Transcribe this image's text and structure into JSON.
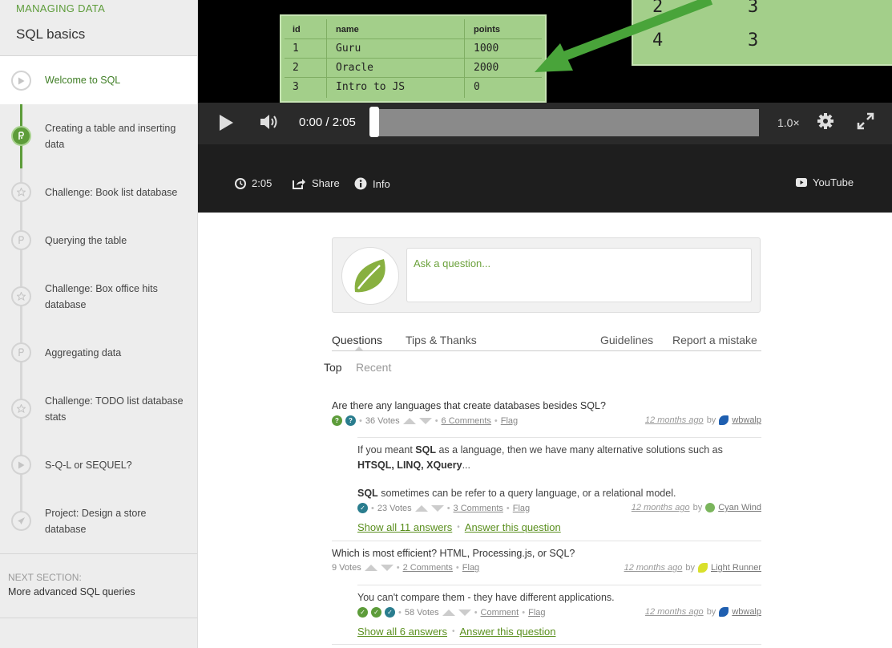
{
  "sidebar": {
    "eyebrow": "MANAGING DATA",
    "title": "SQL basics",
    "items": [
      {
        "label": "Welcome to SQL",
        "icon": "play-icon"
      },
      {
        "label": "Creating a table and inserting data",
        "icon": "talkthrough-icon"
      },
      {
        "label": "Challenge: Book list database",
        "icon": "star-icon"
      },
      {
        "label": "Querying the table",
        "icon": "talkthrough-icon"
      },
      {
        "label": "Challenge: Box office hits database",
        "icon": "star-icon"
      },
      {
        "label": "Aggregating data",
        "icon": "talkthrough-icon"
      },
      {
        "label": "Challenge: TODO list database stats",
        "icon": "star-icon"
      },
      {
        "label": "S-Q-L or SEQUEL?",
        "icon": "play-icon"
      },
      {
        "label": "Project: Design a store database",
        "icon": "rocket-icon"
      }
    ],
    "next_label": "NEXT SECTION:",
    "next_title": "More advanced SQL queries"
  },
  "video": {
    "table1": {
      "headers": [
        "id",
        "name",
        "points"
      ],
      "rows": [
        [
          "1",
          "Guru",
          "1000"
        ],
        [
          "2",
          "Oracle",
          "2000"
        ],
        [
          "3",
          "Intro to JS",
          "0"
        ]
      ]
    },
    "table2": {
      "rows": [
        [
          "2",
          "3"
        ],
        [
          "4",
          "3"
        ]
      ]
    },
    "time": "0:00 / 2:05",
    "progress": 0,
    "speed": "1.0×",
    "duration": "2:05",
    "share": "Share",
    "info": "Info",
    "youtube": "YouTube"
  },
  "ask": {
    "placeholder": "Ask a question..."
  },
  "tabs": {
    "questions": "Questions",
    "tips": "Tips & Thanks",
    "guidelines": "Guidelines",
    "report": "Report a mistake",
    "top": "Top",
    "recent": "Recent"
  },
  "questions": [
    {
      "title": "Are there any languages that create databases besides SQL?",
      "votes": "36 Votes",
      "comments": "6 Comments",
      "flag": "Flag",
      "time": "12 months ago",
      "by": "by",
      "user": "wbwalp",
      "answer_text_1": "If you meant",
      "answer_bold_1": "SQL",
      "answer_text_2": "as a language, then we have many alternative solutions such as",
      "answer_bold_2": "HTSQL, LINQ, XQuery",
      "answer_text_3": "...",
      "answer_bold_3": "SQL",
      "answer_text_4": "sometimes can be refer to a query language, or a relational model.",
      "answer_votes": "23 Votes",
      "answer_comments": "3 Comments",
      "answer_flag": "Flag",
      "answer_time": "12 months ago",
      "answer_by": "by",
      "answer_user": "Cyan Wind",
      "show_all": "Show all 11 answers",
      "answer_this": "Answer this question"
    },
    {
      "title": "Which is most efficient? HTML, Processing.js, or SQL?",
      "votes": "9 Votes",
      "comments": "2 Comments",
      "flag": "Flag",
      "time": "12 months ago",
      "by": "by",
      "user": "Light Runner",
      "answer_text": "You can't compare them - they have different applications.",
      "answer_votes": "58 Votes",
      "answer_comments": "Comment",
      "answer_flag": "Flag",
      "answer_time": "12 months ago",
      "answer_by": "by",
      "answer_user": "wbwalp",
      "show_all": "Show all 6 answers",
      "answer_this": "Answer this question"
    }
  ],
  "colors": {
    "accent": "#5d9c3a",
    "link": "#5a8f1e"
  }
}
